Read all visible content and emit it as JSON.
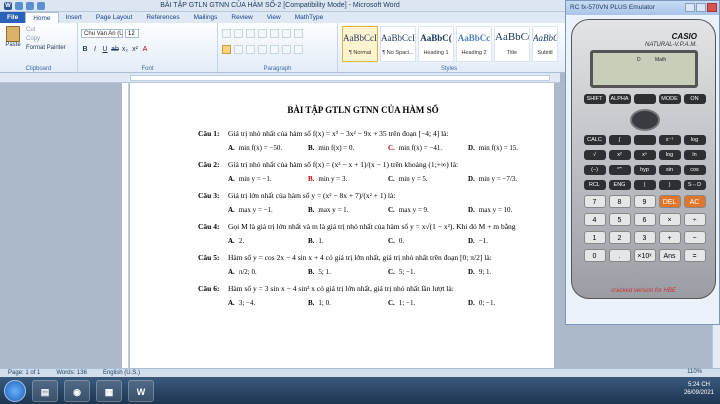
{
  "window": {
    "title": "BÀI TẬP GTLN GTNN CỦA HÀM SỐ-2 [Compatibility Mode] - Microsoft Word"
  },
  "tabs": [
    "File",
    "Home",
    "Insert",
    "Page Layout",
    "References",
    "Mailings",
    "Review",
    "View",
    "MathType"
  ],
  "ribbon": {
    "clipboard": {
      "paste": "Paste",
      "cut": "Cut",
      "copy": "Copy",
      "format_painter": "Format Painter",
      "label": "Clipboard"
    },
    "font": {
      "name": "Chu Van An (Ur",
      "size": "12",
      "label": "Font"
    },
    "paragraph": {
      "label": "Paragraph"
    },
    "styles": {
      "label": "Styles",
      "items": [
        {
          "sample": "AaBbCcI",
          "name": "¶ Normal"
        },
        {
          "sample": "AaBbCcI",
          "name": "¶ No Spaci..."
        },
        {
          "sample": "AaBbC(",
          "name": "Heading 1"
        },
        {
          "sample": "AaBbCc",
          "name": "Heading 2"
        },
        {
          "sample": "AaBbC(",
          "name": "Title"
        },
        {
          "sample": "AaBbCcI",
          "name": "Subtitl"
        }
      ]
    }
  },
  "document": {
    "title": "BÀI TẬP GTLN GTNN CỦA HÀM SỐ",
    "questions": [
      {
        "label": "Câu 1:",
        "text": "Giá trị nhỏ nhất của hàm số f(x) = x³ − 3x² − 9x + 35 trên đoạn [−4; 4] là:",
        "answers": [
          [
            "A.",
            "min f(x) = −50."
          ],
          [
            "B.",
            "min f(x) = 0."
          ],
          [
            "C.",
            "min f(x) = −41."
          ],
          [
            "D.",
            "min f(x) = 15."
          ]
        ]
      },
      {
        "label": "Câu 2:",
        "text": "Giá trị nhỏ nhất của hàm số f(x) = (x² − x + 1)/(x − 1) trên khoảng (1;+∞) là:",
        "answers": [
          [
            "A.",
            "min y = −1."
          ],
          [
            "B.",
            "min y = 3."
          ],
          [
            "C.",
            "min y = 5."
          ],
          [
            "D.",
            "min y = −7/3."
          ]
        ]
      },
      {
        "label": "Câu 3:",
        "text": "Giá trị lớn nhất của hàm số y = (x² − 8x + 7)/(x² + 1) là:",
        "answers": [
          [
            "A.",
            "max y = −1."
          ],
          [
            "B.",
            "max y = 1."
          ],
          [
            "C.",
            "max y = 9."
          ],
          [
            "D.",
            "max y = 10."
          ]
        ]
      },
      {
        "label": "Câu 4:",
        "text": "Gọi M là giá trị lớn nhất và m là giá trị nhỏ nhất của hàm số y = x√(1 − x²). Khi đó M + m bằng",
        "answers": [
          [
            "A.",
            "2."
          ],
          [
            "B.",
            "1."
          ],
          [
            "C.",
            "0."
          ],
          [
            "D.",
            "−1."
          ]
        ]
      },
      {
        "label": "Câu 5:",
        "text": "Hàm số y = cos 2x − 4 sin x + 4 có giá trị lớn nhất, giá trị nhỏ nhất trên đoạn [0; π/2] là:",
        "answers": [
          [
            "A.",
            "π/2; 0."
          ],
          [
            "B.",
            "5; 1."
          ],
          [
            "C.",
            "5; −1."
          ],
          [
            "D.",
            "9; 1."
          ]
        ]
      },
      {
        "label": "Câu 6:",
        "text": "Hàm số y = 3 sin x − 4 sin³ x có giá trị lớn nhất, giá trị nhỏ nhất lần lượt là:",
        "answers": [
          [
            "A.",
            "3; −4."
          ],
          [
            "B.",
            "1; 0."
          ],
          [
            "C.",
            "1; −1."
          ],
          [
            "D.",
            "0; −1."
          ]
        ]
      }
    ],
    "highlight_answer": "B"
  },
  "status": {
    "page": "Page: 1 of 1",
    "words": "Words: 136",
    "language": "English (U.S.)",
    "zoom": "110%"
  },
  "calculator": {
    "window_title": "RC fx-570VN PLUS Emulator",
    "brand": "CASIO",
    "model": "NATURAL-V.P.A.M.",
    "indicators": [
      "D",
      "Math"
    ],
    "footer": "cracked version for HBE",
    "rows": [
      [
        "SHIFT",
        "ALPHA",
        "",
        "MODE",
        "ON"
      ],
      [
        "CALC",
        "∫",
        "",
        "x⁻¹",
        "log"
      ],
      [
        "√",
        "x²",
        "xⁿ",
        "log",
        "ln"
      ],
      [
        "(−)",
        "°'\"",
        "hyp",
        "sin",
        "cos"
      ],
      [
        "RCL",
        "ENG",
        "(",
        ")",
        "S⇔D"
      ],
      [
        "7",
        "8",
        "9",
        "DEL",
        "AC"
      ],
      [
        "4",
        "5",
        "6",
        "×",
        "÷"
      ],
      [
        "1",
        "2",
        "3",
        "+",
        "−"
      ],
      [
        "0",
        ".",
        "×10ˣ",
        "Ans",
        "="
      ]
    ]
  },
  "taskbar": {
    "time": "5:24 CH",
    "date": "26/09/2021"
  }
}
